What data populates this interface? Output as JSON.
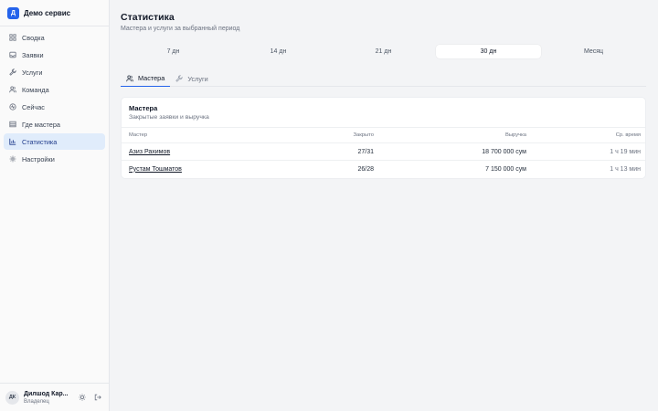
{
  "brand": {
    "logo_letter": "Д",
    "name": "Демо сервис"
  },
  "sidebar": {
    "items": [
      {
        "label": "Сводка",
        "icon": "grid-icon"
      },
      {
        "label": "Заявки",
        "icon": "inbox-icon"
      },
      {
        "label": "Услуги",
        "icon": "wrench-icon"
      },
      {
        "label": "Команда",
        "icon": "team-icon"
      },
      {
        "label": "Сейчас",
        "icon": "activity-icon"
      },
      {
        "label": "Где мастера",
        "icon": "map-icon"
      },
      {
        "label": "Статистика",
        "icon": "bar-chart-icon",
        "active": true
      },
      {
        "label": "Настройки",
        "icon": "gear-icon"
      }
    ]
  },
  "user": {
    "initials": "ДК",
    "name": "Дилшод Кар...",
    "role": "Владелец"
  },
  "page": {
    "title": "Статистика",
    "subtitle": "Мастера и услуги за выбранный период"
  },
  "periods": [
    {
      "label": "7 дн"
    },
    {
      "label": "14 дн"
    },
    {
      "label": "21 дн"
    },
    {
      "label": "30 дн",
      "active": true
    },
    {
      "label": "Месяц"
    }
  ],
  "tabs": [
    {
      "label": "Мастера",
      "active": true,
      "icon": "users-icon"
    },
    {
      "label": "Услуги",
      "icon": "wrench-icon"
    }
  ],
  "card": {
    "title": "Мастера",
    "subtitle": "Закрытые заявки и выручка",
    "columns": [
      "Мастер",
      "Закрыто",
      "Выручка",
      "Ср. время"
    ],
    "rows": [
      {
        "name": "Азиз Рахимов",
        "closed": "27/31",
        "revenue": "18 700 000 сум",
        "avg_time": "1 ч 19 мин"
      },
      {
        "name": "Рустам Тошматов",
        "closed": "26/28",
        "revenue": "7 150 000 сум",
        "avg_time": "1 ч 13 мин"
      }
    ]
  },
  "colors": {
    "accent": "#2563eb",
    "active_nav_bg": "#e0ecfb",
    "background": "#f3f4f6"
  }
}
